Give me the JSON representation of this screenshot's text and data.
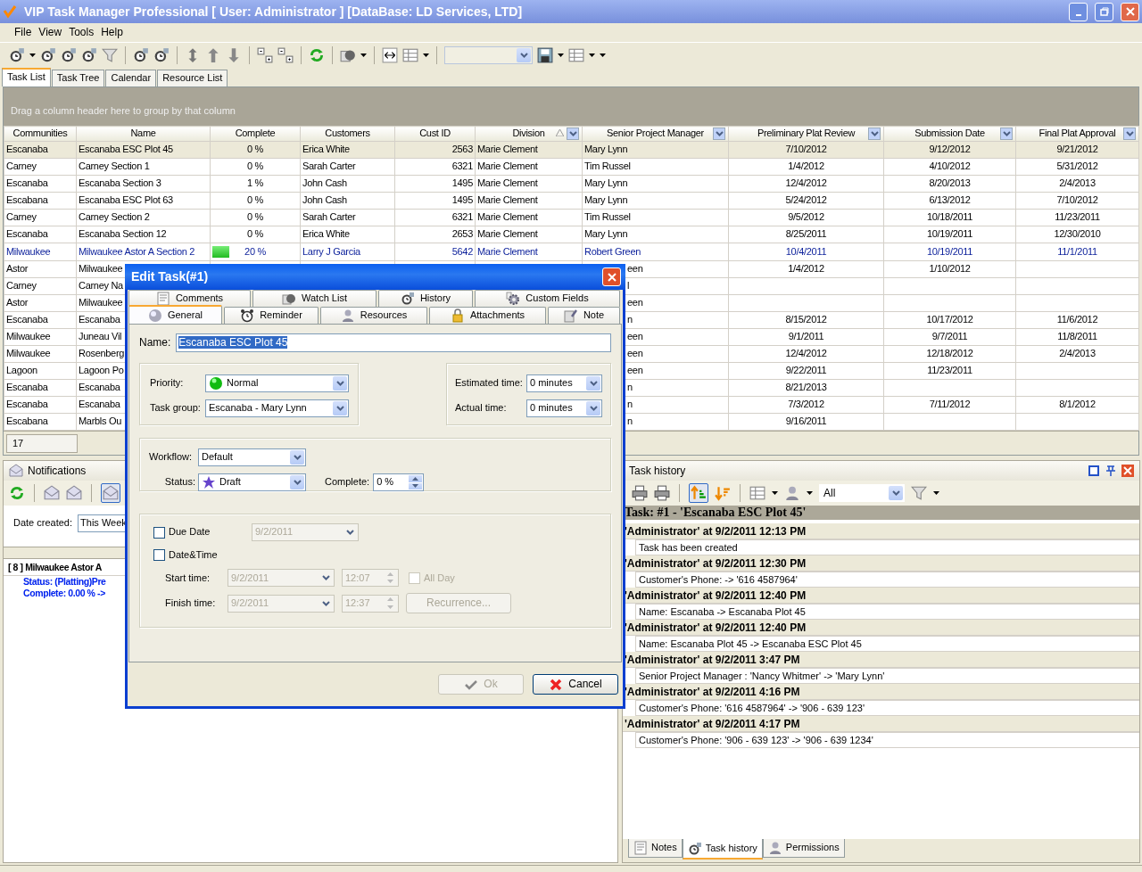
{
  "window": {
    "title": "VIP Task Manager Professional [ User: Administrator ] [DataBase: LD Services, LTD]"
  },
  "menu": [
    {
      "label": "File"
    },
    {
      "label": "View"
    },
    {
      "label": "Tools"
    },
    {
      "label": "Help"
    }
  ],
  "main_tabs": [
    {
      "label": "Task List",
      "selected": true
    },
    {
      "label": "Task Tree",
      "selected": false
    },
    {
      "label": "Calendar",
      "selected": false
    },
    {
      "label": "Resource List",
      "selected": false
    }
  ],
  "grid": {
    "group_hint": "Drag a column header here to group by that column",
    "columns": [
      {
        "label": "Communities",
        "filter": false,
        "sorted": false
      },
      {
        "label": "Name",
        "filter": false,
        "sorted": false
      },
      {
        "label": "Complete",
        "filter": false,
        "sorted": false
      },
      {
        "label": "Customers",
        "filter": false,
        "sorted": false
      },
      {
        "label": "Cust ID",
        "filter": false,
        "sorted": false
      },
      {
        "label": "Division",
        "filter": true,
        "sorted": true
      },
      {
        "label": "Senior Project Manager",
        "filter": true,
        "sorted": false
      },
      {
        "label": "Preliminary Plat Review",
        "filter": true,
        "sorted": false
      },
      {
        "label": "Submission Date",
        "filter": true,
        "sorted": false
      },
      {
        "label": "Final Plat Approval",
        "filter": true,
        "sorted": false
      }
    ],
    "rows": [
      {
        "selected": true,
        "highlighted": false,
        "covered": false,
        "cells": [
          "Escanaba",
          "Escanaba ESC Plot 45",
          "0 %",
          "Erica White",
          "2563",
          "Marie Clement",
          "Mary Lynn",
          "7/10/2012",
          "9/12/2012",
          "9/21/2012"
        ]
      },
      {
        "selected": false,
        "highlighted": false,
        "covered": false,
        "cells": [
          "Carney",
          "Carney Section 1",
          "0 %",
          "Sarah Carter",
          "6321",
          "Marie Clement",
          "Tim Russel",
          "1/4/2012",
          "4/10/2012",
          "5/31/2012"
        ]
      },
      {
        "selected": false,
        "highlighted": false,
        "covered": false,
        "cells": [
          "Escanaba",
          "Escanaba Section 3",
          "1 %",
          "John Cash",
          "1495",
          "Marie Clement",
          "Mary Lynn",
          "12/4/2012",
          "8/20/2013",
          "2/4/2013"
        ]
      },
      {
        "selected": false,
        "highlighted": false,
        "covered": false,
        "cells": [
          "Escabana",
          "Escanaba ESC Plot 63",
          "0 %",
          "John Cash",
          "1495",
          "Marie Clement",
          "Mary Lynn",
          "5/24/2012",
          "6/13/2012",
          "7/10/2012"
        ]
      },
      {
        "selected": false,
        "highlighted": false,
        "covered": false,
        "cells": [
          "Carney",
          "Carney Section 2",
          "0 %",
          "Sarah Carter",
          "6321",
          "Marie Clement",
          "Tim Russel",
          "9/5/2012",
          "10/18/2011",
          "11/23/2011"
        ]
      },
      {
        "selected": false,
        "highlighted": false,
        "covered": false,
        "cells": [
          "Escanaba",
          "Escanaba Section 12",
          "0 %",
          "Erica White",
          "2653",
          "Marie Clement",
          "Mary Lynn",
          "8/25/2011",
          "10/19/2011",
          "12/30/2010"
        ]
      },
      {
        "selected": false,
        "highlighted": true,
        "covered": false,
        "level": 0.2,
        "cells": [
          "Milwaukee",
          "Milwaukee  Astor A Section 2",
          "20 %",
          "Larry J Garcia",
          "5642",
          "Marie Clement",
          "Robert Green",
          "10/4/2011",
          "10/19/2011",
          "11/1/2011"
        ]
      },
      {
        "selected": false,
        "highlighted": false,
        "covered": true,
        "cells": [
          "Astor",
          "Milwaukee",
          null,
          null,
          null,
          null,
          "een",
          "1/4/2012",
          "1/10/2012",
          null
        ]
      },
      {
        "selected": false,
        "highlighted": false,
        "covered": true,
        "cells": [
          "Carney",
          "Carney Na",
          null,
          null,
          null,
          null,
          "l",
          null,
          null,
          null
        ]
      },
      {
        "selected": false,
        "highlighted": false,
        "covered": true,
        "cells": [
          "Astor",
          "Milwaukee",
          null,
          null,
          null,
          null,
          "een",
          null,
          null,
          null
        ]
      },
      {
        "selected": false,
        "highlighted": false,
        "covered": true,
        "cells": [
          "Escanaba",
          "Escanaba",
          null,
          null,
          null,
          null,
          "n",
          "8/15/2012",
          "10/17/2012",
          "11/6/2012"
        ]
      },
      {
        "selected": false,
        "highlighted": false,
        "covered": true,
        "cells": [
          "Milwaukee",
          "Juneau Vil",
          null,
          null,
          null,
          null,
          "een",
          "9/1/2011",
          "9/7/2011",
          "11/8/2011"
        ]
      },
      {
        "selected": false,
        "highlighted": false,
        "covered": true,
        "cells": [
          "Milwaukee",
          "Rosenberg",
          null,
          null,
          null,
          null,
          "een",
          "12/4/2012",
          "12/18/2012",
          "2/4/2013"
        ]
      },
      {
        "selected": false,
        "highlighted": false,
        "covered": true,
        "cells": [
          "Lagoon",
          "Lagoon Po",
          null,
          null,
          null,
          null,
          "een",
          "9/22/2011",
          "11/23/2011",
          null
        ]
      },
      {
        "selected": false,
        "highlighted": false,
        "covered": true,
        "cells": [
          "Escanaba",
          "Escanaba",
          null,
          null,
          null,
          null,
          "n",
          "8/21/2013",
          null,
          null
        ]
      },
      {
        "selected": false,
        "highlighted": false,
        "covered": true,
        "cells": [
          "Escanaba",
          "Escanaba",
          null,
          null,
          null,
          null,
          "n",
          "7/3/2012",
          "7/11/2012",
          "8/1/2012"
        ]
      },
      {
        "selected": false,
        "highlighted": false,
        "covered": true,
        "cells": [
          "Escabana",
          "Marbls Ou",
          null,
          null,
          null,
          null,
          "n",
          "9/16/2011",
          null,
          null
        ]
      }
    ],
    "footer": "17"
  },
  "notifications": {
    "title": "Notifications",
    "date_label": "Date created:",
    "date_value": "This Week",
    "item_title": "[ 8 ] Milwaukee  Astor A",
    "item_lines": [
      "Status: (Platting)Pre",
      "Complete: 0.00 % ->"
    ]
  },
  "task_history": {
    "title": "Task history",
    "filter_value": "All",
    "task_heading": "Task: #1 - 'Escanaba ESC Plot 45'",
    "entries": [
      {
        "header": "'Administrator' at 9/2/2011 12:13 PM",
        "detail": "Task has been created"
      },
      {
        "header": "'Administrator' at 9/2/2011 12:30 PM",
        "detail": "Customer's Phone:  -> '616 4587964'"
      },
      {
        "header": "'Administrator' at 9/2/2011 12:40 PM",
        "detail": "Name: Escanaba -> Escanaba Plot 45"
      },
      {
        "header": "'Administrator' at 9/2/2011 12:40 PM",
        "detail": "Name: Escanaba Plot 45 -> Escanaba ESC Plot 45"
      },
      {
        "header": "'Administrator' at 9/2/2011 3:47 PM",
        "detail": "Senior Project Manager : 'Nancy Whitmer' -> 'Mary Lynn'"
      },
      {
        "header": "'Administrator' at 9/2/2011 4:16 PM",
        "detail": "Customer's Phone: '616 4587964' -> '906 - 639 123'"
      },
      {
        "header": "'Administrator' at 9/2/2011 4:17 PM",
        "detail": "Customer's Phone: '906 - 639 123' -> '906 - 639 1234'"
      }
    ]
  },
  "bottom_tabs": [
    {
      "label": "Notes",
      "selected": false
    },
    {
      "label": "Task history",
      "selected": true
    },
    {
      "label": "Permissions",
      "selected": false
    }
  ],
  "dialog": {
    "title": "Edit Task(#1)",
    "tabs_back": [
      {
        "label": "Comments",
        "selected": false
      },
      {
        "label": "Watch List",
        "selected": false
      },
      {
        "label": "History",
        "selected": false
      },
      {
        "label": "Custom Fields",
        "selected": false
      }
    ],
    "tabs_front": [
      {
        "label": "General",
        "selected": true
      },
      {
        "label": "Reminder",
        "selected": false
      },
      {
        "label": "Resources",
        "selected": false
      },
      {
        "label": "Attachments",
        "selected": false
      },
      {
        "label": "Note",
        "selected": false
      }
    ],
    "name_label": "Name:",
    "name_value": "Escanaba ESC Plot 45",
    "priority": {
      "label": "Priority:",
      "value": "Normal"
    },
    "task_group": {
      "label": "Task group:",
      "value": "Escanaba - Mary Lynn"
    },
    "estimated": {
      "label": "Estimated time:",
      "value": "0 minutes"
    },
    "actual": {
      "label": "Actual time:",
      "value": "0 minutes"
    },
    "workflow": {
      "label": "Workflow:",
      "value": "Default"
    },
    "status": {
      "label": "Status:",
      "value": "Draft"
    },
    "complete": {
      "label": "Complete:",
      "value": "0 %"
    },
    "due_date": {
      "label": "Due Date",
      "checked": false,
      "value": "9/2/2011",
      "disabled": true
    },
    "date_time": {
      "label": "Date&Time",
      "checked": false
    },
    "start": {
      "label": "Start time:",
      "date": "9/2/2011",
      "time": "12:07",
      "disabled": true
    },
    "all_day": {
      "label": "All Day",
      "checked": false,
      "disabled": true
    },
    "finish": {
      "label": "Finish time:",
      "date": "9/2/2011",
      "time": "12:37",
      "disabled": true
    },
    "recurrence": {
      "label": "Recurrence...",
      "disabled": true
    },
    "buttons": [
      {
        "label": "Ok",
        "kind": "ok",
        "disabled": true
      },
      {
        "label": "Cancel",
        "kind": "cancel",
        "disabled": false
      }
    ]
  }
}
